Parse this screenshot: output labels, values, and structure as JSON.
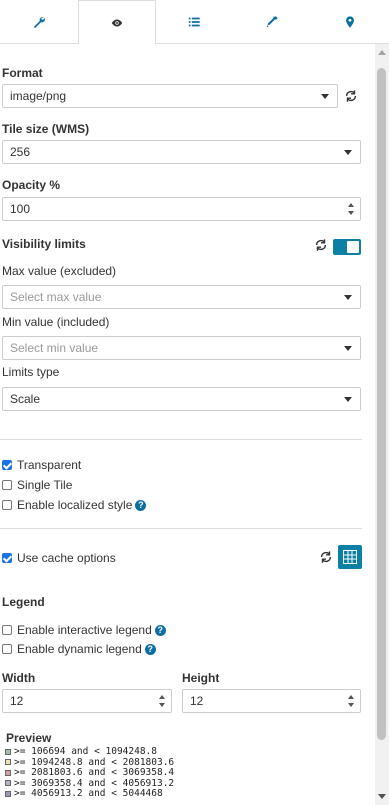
{
  "tabs": [
    {
      "name": "wrench-icon"
    },
    {
      "name": "eye-icon"
    },
    {
      "name": "list-icon"
    },
    {
      "name": "dropper-icon"
    },
    {
      "name": "map-marker-icon"
    }
  ],
  "format": {
    "label": "Format",
    "value": "image/png"
  },
  "tile_size": {
    "label": "Tile size (WMS)",
    "value": "256"
  },
  "opacity": {
    "label": "Opacity %",
    "value": "100"
  },
  "visibility": {
    "label": "Visibility limits",
    "max_label": "Max value (excluded)",
    "max_placeholder": "Select max value",
    "min_label": "Min value (included)",
    "min_placeholder": "Select min value",
    "type_label": "Limits type",
    "type_value": "Scale"
  },
  "options": {
    "transparent": "Transparent",
    "single_tile": "Single Tile",
    "localized_style": "Enable localized style",
    "use_cache": "Use cache options"
  },
  "legend": {
    "title": "Legend",
    "interactive": "Enable interactive legend",
    "dynamic": "Enable dynamic legend",
    "width_label": "Width",
    "width_value": "12",
    "height_label": "Height",
    "height_value": "12",
    "preview_label": "Preview",
    "entries": [
      {
        "text": ">= 106694 and < 1094248.8",
        "color": "#a6bfa8"
      },
      {
        "text": ">= 1094248.8 and < 2081803.6",
        "color": "#e8e4b0"
      },
      {
        "text": ">= 2081803.6 and < 3069358.4",
        "color": "#d4a0a0"
      },
      {
        "text": ">= 3069358.4 and < 4056913.2",
        "color": "#b4b4c8"
      },
      {
        "text": ">= 4056913.2 and < 5044468",
        "color": "#9a9ab8"
      }
    ]
  },
  "colors": {
    "accent": "#0b7fa4",
    "link": "#0b6fa4"
  }
}
